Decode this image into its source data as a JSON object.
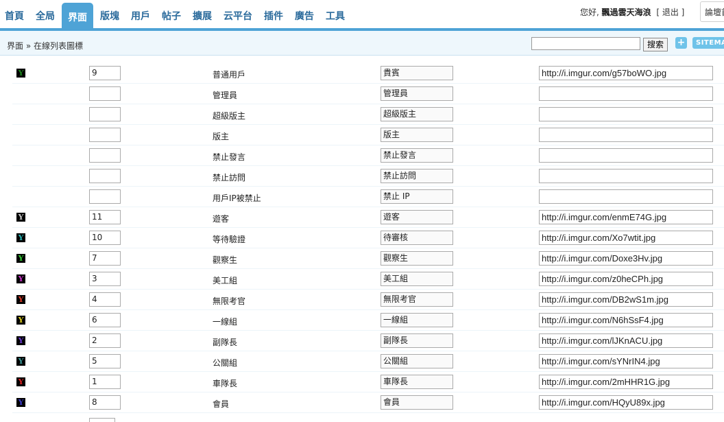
{
  "nav": {
    "items": [
      "首頁",
      "全局",
      "界面",
      "版塊",
      "用戶",
      "帖子",
      "擴展",
      "云平台",
      "插件",
      "廣告",
      "工具"
    ],
    "active_index": 2
  },
  "header": {
    "greeting": "您好,",
    "username": "飄過雲天海浪",
    "logout_open": "[",
    "logout": "退出",
    "logout_close": "]",
    "forum_button": "論壇首頁"
  },
  "breadcrumb": "界面 » 在線列表圖標",
  "search": {
    "button_label": "搜索",
    "value": ""
  },
  "toolbar": {
    "add_label": "+",
    "sitemap_label": "SITEMAP"
  },
  "colors": {
    "accent": "#4ea3d6",
    "subbar_bg": "#eef7fc",
    "icon_button": "#6fc3e9"
  },
  "rows": [
    {
      "icon": "Y",
      "icon_color": "#1c8a1c",
      "order": "9",
      "name": "普通用戶",
      "title": "貴賓",
      "url": "http://i.imgur.com/g57boWO.jpg"
    },
    {
      "icon": "",
      "icon_color": "",
      "order": "",
      "name": "管理員",
      "title": "管理員",
      "url": ""
    },
    {
      "icon": "",
      "icon_color": "",
      "order": "",
      "name": "超級版主",
      "title": "超級版主",
      "url": ""
    },
    {
      "icon": "",
      "icon_color": "",
      "order": "",
      "name": "版主",
      "title": "版主",
      "url": ""
    },
    {
      "icon": "",
      "icon_color": "",
      "order": "",
      "name": "禁止發言",
      "title": "禁止發言",
      "url": ""
    },
    {
      "icon": "",
      "icon_color": "",
      "order": "",
      "name": "禁止訪問",
      "title": "禁止訪問",
      "url": ""
    },
    {
      "icon": "",
      "icon_color": "",
      "order": "",
      "name": "用戶IP被禁止",
      "title": "禁止 IP",
      "url": ""
    },
    {
      "icon": "Y",
      "icon_color": "#c8c8c8",
      "order": "11",
      "name": "遊客",
      "title": "遊客",
      "url": "http://i.imgur.com/enmE74G.jpg"
    },
    {
      "icon": "Y",
      "icon_color": "#2ab5b5",
      "order": "10",
      "name": "等待驗證",
      "title": "待審核",
      "url": "http://i.imgur.com/Xo7wtit.jpg"
    },
    {
      "icon": "Y",
      "icon_color": "#33cc33",
      "order": "7",
      "name": "觀察生",
      "title": "觀察生",
      "url": "http://i.imgur.com/Doxe3Hv.jpg"
    },
    {
      "icon": "Y",
      "icon_color": "#cc33cc",
      "order": "3",
      "name": "美工組",
      "title": "美工組",
      "url": "http://i.imgur.com/z0heCPh.jpg"
    },
    {
      "icon": "Y",
      "icon_color": "#e03c2a",
      "order": "4",
      "name": "無限考官",
      "title": "無限考官",
      "url": "http://i.imgur.com/DB2wS1m.jpg"
    },
    {
      "icon": "Y",
      "icon_color": "#e0d020",
      "order": "6",
      "name": "一線組",
      "title": "一線組",
      "url": "http://i.imgur.com/N6hSsF4.jpg"
    },
    {
      "icon": "Y",
      "icon_color": "#6a3ad0",
      "order": "2",
      "name": "副隊長",
      "title": "副隊長",
      "url": "http://i.imgur.com/lJKnACU.jpg"
    },
    {
      "icon": "Y",
      "icon_color": "#3a9a9a",
      "order": "5",
      "name": "公關組",
      "title": "公關組",
      "url": "http://i.imgur.com/sYNrIN4.jpg"
    },
    {
      "icon": "Y",
      "icon_color": "#e02020",
      "order": "1",
      "name": "車隊長",
      "title": "車隊長",
      "url": "http://i.imgur.com/2mHHR1G.jpg"
    },
    {
      "icon": "Y",
      "icon_color": "#3a3acc",
      "order": "8",
      "name": "會員",
      "title": "會員",
      "url": "http://i.imgur.com/HQyU89x.jpg"
    }
  ]
}
